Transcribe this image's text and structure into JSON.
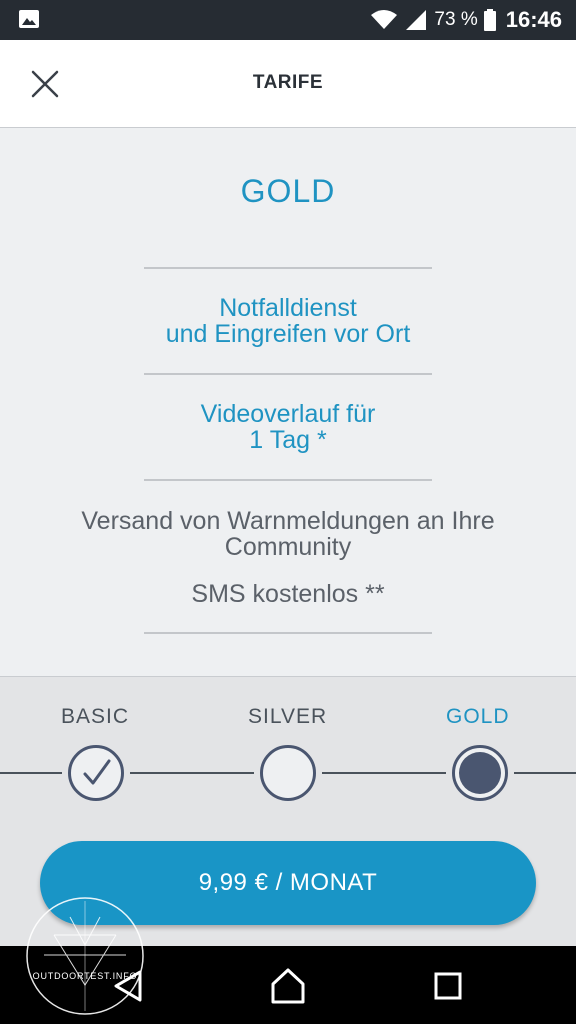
{
  "status_bar": {
    "battery_percent": "73 %",
    "time": "16:46",
    "icons": [
      "gallery-icon",
      "wifi-icon",
      "signal-icon",
      "battery-icon"
    ]
  },
  "app_bar": {
    "title": "TARIFE",
    "close_icon": "close-icon"
  },
  "plan": {
    "name": "GOLD",
    "features": [
      {
        "line1": "Notfalldienst",
        "line2": "und Eingreifen vor Ort"
      },
      {
        "line1": "Videoverlauf für",
        "line2": "1 Tag *"
      },
      {
        "line1": "Versand von Warnmeldungen an Ihre",
        "line2": "Community"
      },
      {
        "line1": "SMS kostenlos **"
      }
    ]
  },
  "tiers": [
    {
      "label": "BASIC",
      "state": "completed"
    },
    {
      "label": "SILVER",
      "state": "empty"
    },
    {
      "label": "GOLD",
      "state": "selected"
    }
  ],
  "price_button": {
    "label": "9,99 € / MONAT"
  },
  "watermark": {
    "text": "OUTDOORTEST.INFO"
  },
  "nav_bar": {
    "icons": [
      "back-icon",
      "home-icon",
      "recents-icon"
    ]
  },
  "colors": {
    "accent": "#1f93c2",
    "button": "#1995c6",
    "tier_dark": "#4a5670"
  }
}
